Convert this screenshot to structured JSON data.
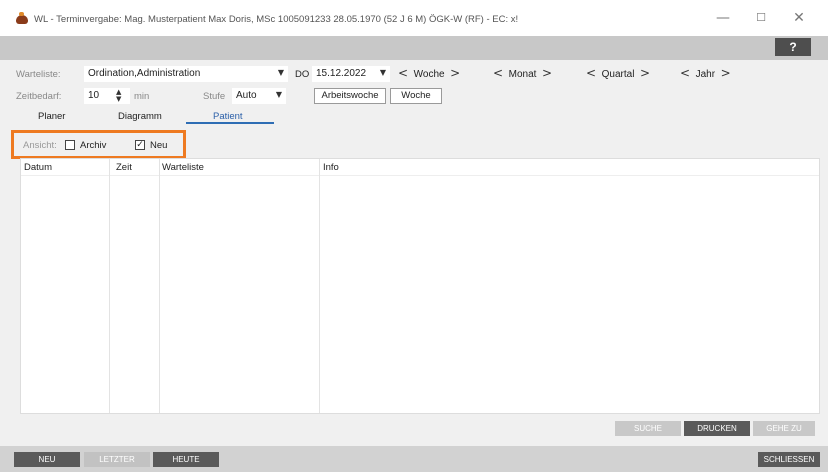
{
  "window": {
    "title": "WL - Terminvergabe: Mag. Musterpatient Max Doris, MSc    1005091233 28.05.1970 (52 J 6 M)    ÖGK-W (RF) - EC: x!",
    "minimize": "—",
    "maximize": "☐",
    "close": "✕"
  },
  "toolbar": {
    "help": "?"
  },
  "form": {
    "warteliste_label": "Warteliste:",
    "warteliste_value": "Ordination,Administration",
    "day_label": "DO",
    "date_value": "15.12.2022",
    "zeitbedarf_label": "Zeitbedarf:",
    "zeitbedarf_value": "10",
    "zeitbedarf_unit": "min",
    "stufe_label": "Stufe",
    "stufe_value": "Auto",
    "btn_arbeitswoche": "Arbeitswoche",
    "btn_woche": "Woche"
  },
  "nav": {
    "woche": "Woche",
    "monat": "Monat",
    "quartal": "Quartal",
    "jahr": "Jahr",
    "prev": "<",
    "next": ">"
  },
  "tabs": {
    "planer": "Planer",
    "diagramm": "Diagramm",
    "patient": "Patient"
  },
  "filter": {
    "ansicht_label": "Ansicht:",
    "archiv_label": "Archiv",
    "archiv_checked": false,
    "neu_label": "Neu",
    "neu_checked": true
  },
  "table": {
    "columns": [
      "Datum",
      "Zeit",
      "Warteliste",
      "Info"
    ],
    "rows": []
  },
  "actions": {
    "suche": "SUCHE",
    "drucken": "DRUCKEN",
    "gehe_zu": "GEHE ZU"
  },
  "bottom": {
    "neu": "NEU",
    "letzter": "LETZTER",
    "heute": "HEUTE",
    "schliessen": "SCHLIESSEN"
  },
  "colors": {
    "accent_orange": "#ee7a21",
    "tab_blue": "#2e6db4",
    "button_dark": "#5a5a5a",
    "button_disabled": "#c8c8c8"
  }
}
